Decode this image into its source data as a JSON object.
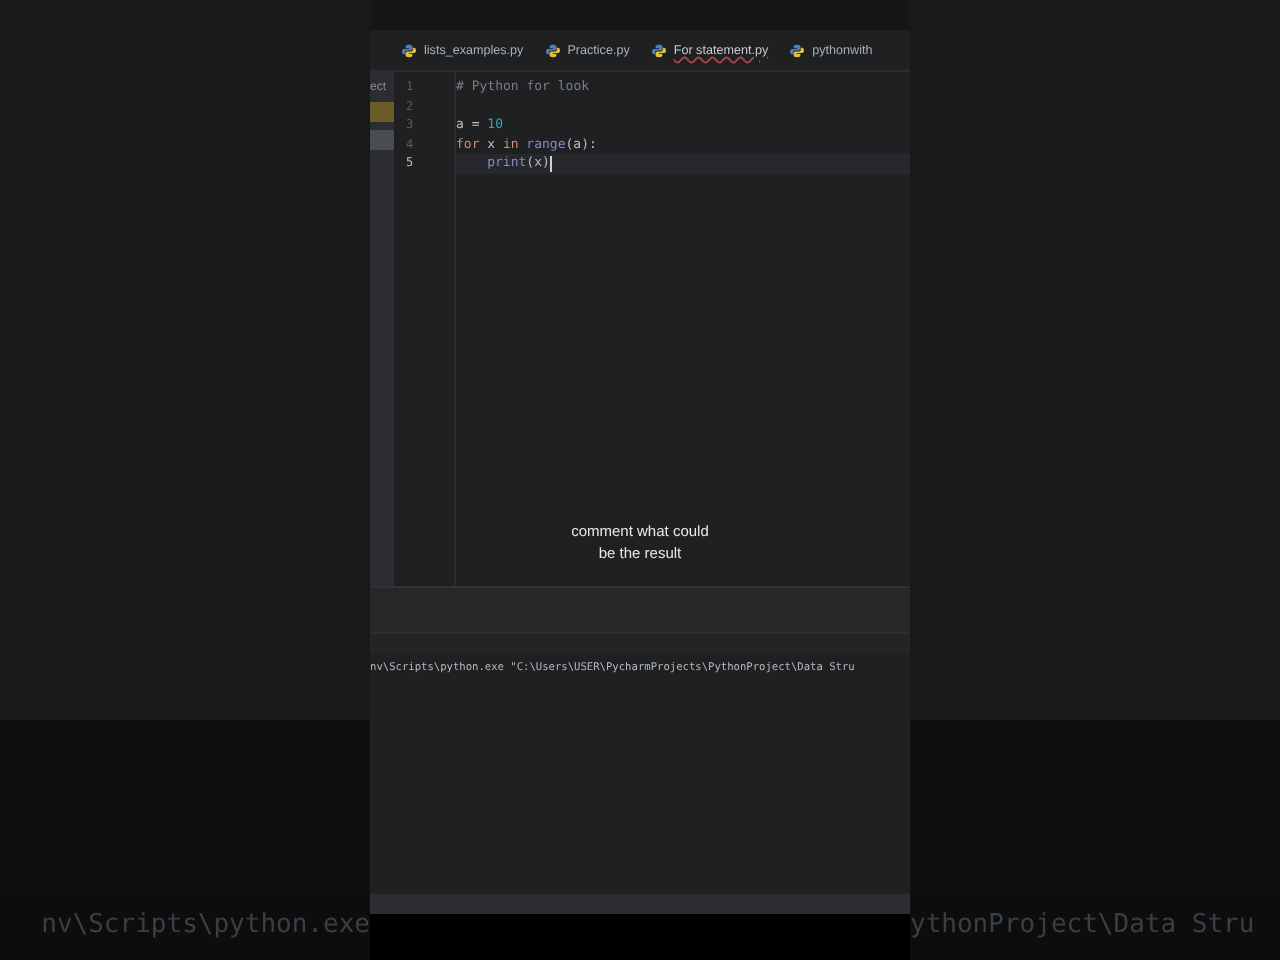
{
  "tabs": [
    {
      "label": "lists_examples.py",
      "selected": false
    },
    {
      "label": "Practice.py",
      "selected": false
    },
    {
      "label": "For statement.py",
      "selected": true
    },
    {
      "label": "pythonwith",
      "selected": false
    }
  ],
  "project_panel": {
    "label": "ect"
  },
  "editor": {
    "lines": [
      {
        "number": "1",
        "current": false,
        "tokens": [
          {
            "kind": "comment",
            "text": "# Python for look"
          }
        ]
      },
      {
        "number": "2",
        "current": false
      },
      {
        "number": "3",
        "current": false,
        "tokens": [
          {
            "kind": "plain",
            "text": "a = "
          },
          {
            "kind": "number",
            "text": "10"
          }
        ]
      },
      {
        "number": "4",
        "current": false,
        "tokens": [
          {
            "kind": "keyword",
            "text": "for"
          },
          {
            "kind": "plain",
            "text": "x",
            "space_before": true
          },
          {
            "kind": "keyword",
            "text": "in",
            "space_before": true
          },
          {
            "kind": "builtin",
            "text": "range",
            "space_before": true
          },
          {
            "kind": "plain",
            "text": "(a):"
          }
        ]
      },
      {
        "number": "5",
        "current": true,
        "indented": true,
        "tokens": [
          {
            "kind": "builtin",
            "text": "print"
          },
          {
            "kind": "plain",
            "text": "(x)"
          }
        ]
      }
    ]
  },
  "caption": [
    "comment what could",
    "be the result"
  ],
  "terminal": {
    "command": "nv\\Scripts\\python.exe \"C:\\Users\\USER\\PycharmProjects\\PythonProject\\Data Stru"
  },
  "background": {
    "left_text": "nv\\Scripts\\python.exe",
    "right_text": "ythonProject\\Data Stru"
  }
}
